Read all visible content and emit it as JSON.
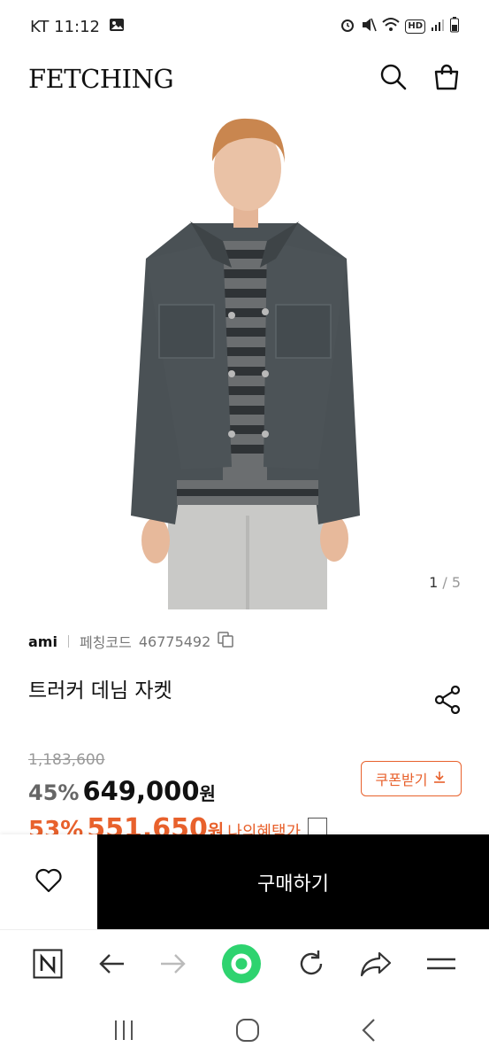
{
  "status": {
    "carrier_time": "KT 11:12",
    "gallery_icon": "image-icon",
    "right_icons": [
      "alarm-icon",
      "mute-icon",
      "wifi-icon",
      "hd-icon",
      "signal-icon",
      "battery-icon"
    ],
    "hd_label": "HD"
  },
  "header": {
    "logo": "FETCHING",
    "search_icon": "search-icon",
    "bag_icon": "shopping-bag-icon"
  },
  "gallery": {
    "current": "1",
    "separator": " / ",
    "total": "5"
  },
  "product": {
    "brand": "ami",
    "code_label": "페칭코드",
    "code": "46775492",
    "title": "트러커 데님 자켓",
    "original_price": "1,183,600",
    "discount": "45%",
    "price": "649,000",
    "currency": "원",
    "benefit_discount": "53%",
    "benefit_price": "551,650",
    "benefit_currency": "원",
    "benefit_label": "나의혜택가",
    "coupon_label": "쿠폰받기"
  },
  "actions": {
    "buy_label": "구매하기"
  },
  "colors": {
    "accent": "#e8612c",
    "buy_bg": "#000000",
    "browser_home": "#2ed36f"
  }
}
